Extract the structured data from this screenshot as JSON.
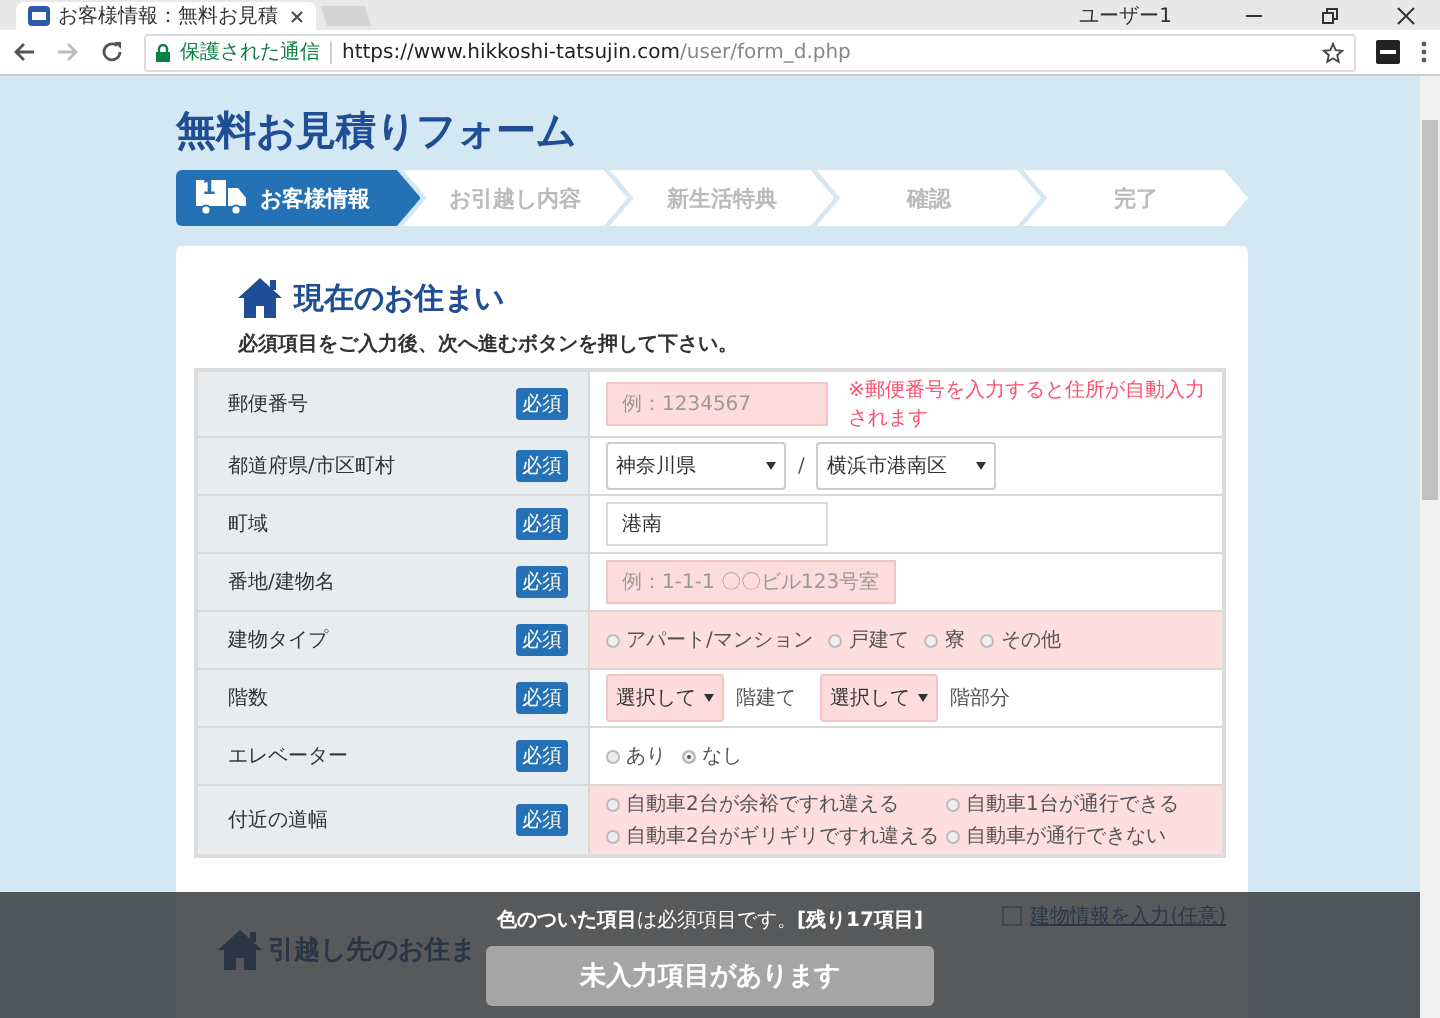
{
  "browser": {
    "tab_title": "お客様情報：無料お見積",
    "user": "ユーザー1",
    "secure_label": "保護された通信",
    "url_host": "https://www.hikkoshi-tatsujin.com",
    "url_path": "/user/form_d.php"
  },
  "page_title": "無料お見積りフォーム",
  "steps": [
    {
      "label": "お客様情報",
      "selected": true
    },
    {
      "label": "お引越し内容",
      "selected": false
    },
    {
      "label": "新生活特典",
      "selected": false
    },
    {
      "label": "確認",
      "selected": false
    },
    {
      "label": "完了",
      "selected": false
    }
  ],
  "step_number": "1",
  "section_title": "現在のお住まい",
  "instruction": "必須項目をご入力後、次へ進むボタンを押して下さい。",
  "rows": [
    {
      "kind": "input",
      "label": "郵便番号",
      "badge": "必須",
      "highlighted": false,
      "input": {
        "placeholder": "例：1234567",
        "highlighted": true
      },
      "note": "※郵便番号を入力すると住所が自動入力されます"
    },
    {
      "kind": "selects",
      "label": "都道府県/市区町村",
      "badge": "必須",
      "highlighted": false,
      "selects": [
        "神奈川県",
        "横浜市港南区"
      ],
      "separator": "/"
    },
    {
      "kind": "input",
      "label": "町域",
      "badge": "必須",
      "highlighted": false,
      "input": {
        "value": "港南",
        "highlighted": false
      }
    },
    {
      "kind": "input",
      "label": "番地/建物名",
      "badge": "必須",
      "highlighted": false,
      "input": {
        "placeholder": "例：1-1-1 〇〇ビル123号室",
        "highlighted": true
      }
    },
    {
      "kind": "radios",
      "label": "建物タイプ",
      "badge": "必須",
      "highlighted": true,
      "options": [
        {
          "label": "アパート/マンション",
          "selected": false
        },
        {
          "label": "戸建て",
          "selected": false
        },
        {
          "label": "寮",
          "selected": false
        },
        {
          "label": "その他",
          "selected": false
        }
      ]
    },
    {
      "kind": "floors",
      "label": "階数",
      "badge": "必須",
      "highlighted": false,
      "parts": [
        {
          "select": "選択して",
          "suffix": "階建て"
        },
        {
          "select": "選択して",
          "suffix": "階部分"
        }
      ]
    },
    {
      "kind": "radios",
      "label": "エレベーター",
      "badge": "必須",
      "highlighted": false,
      "options": [
        {
          "label": "あり",
          "selected": false
        },
        {
          "label": "なし",
          "selected": true
        }
      ]
    },
    {
      "kind": "radio-grid",
      "label": "付近の道幅",
      "badge": "必須",
      "highlighted": true,
      "options": [
        {
          "label": "自動車2台が余裕ですれ違える",
          "selected": false
        },
        {
          "label": "自動車1台が通行できる",
          "selected": false
        },
        {
          "label": "自動車2台がギリギリですれ違える",
          "selected": false
        },
        {
          "label": "自動車が通行できない",
          "selected": false
        }
      ]
    }
  ],
  "optional_link": {
    "label": "建物情報を入力(任意)",
    "checked": false
  },
  "next_section_title": "引越し先のお住ま",
  "footer": {
    "message": "**色のついた項目**は必須項目です。**[残り17項目]**",
    "button": "未入力項目があります",
    "disabled": true
  }
}
